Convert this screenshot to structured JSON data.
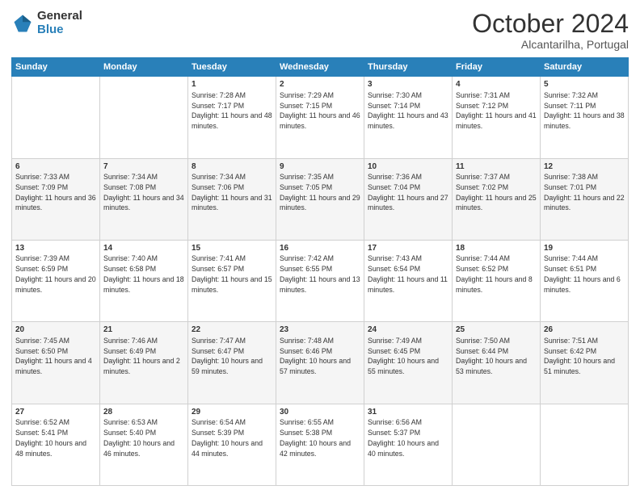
{
  "logo": {
    "general": "General",
    "blue": "Blue"
  },
  "title": "October 2024",
  "subtitle": "Alcantarilha, Portugal",
  "days_header": [
    "Sunday",
    "Monday",
    "Tuesday",
    "Wednesday",
    "Thursday",
    "Friday",
    "Saturday"
  ],
  "weeks": [
    [
      {
        "num": "",
        "sunrise": "",
        "sunset": "",
        "daylight": ""
      },
      {
        "num": "",
        "sunrise": "",
        "sunset": "",
        "daylight": ""
      },
      {
        "num": "1",
        "sunrise": "Sunrise: 7:28 AM",
        "sunset": "Sunset: 7:17 PM",
        "daylight": "Daylight: 11 hours and 48 minutes."
      },
      {
        "num": "2",
        "sunrise": "Sunrise: 7:29 AM",
        "sunset": "Sunset: 7:15 PM",
        "daylight": "Daylight: 11 hours and 46 minutes."
      },
      {
        "num": "3",
        "sunrise": "Sunrise: 7:30 AM",
        "sunset": "Sunset: 7:14 PM",
        "daylight": "Daylight: 11 hours and 43 minutes."
      },
      {
        "num": "4",
        "sunrise": "Sunrise: 7:31 AM",
        "sunset": "Sunset: 7:12 PM",
        "daylight": "Daylight: 11 hours and 41 minutes."
      },
      {
        "num": "5",
        "sunrise": "Sunrise: 7:32 AM",
        "sunset": "Sunset: 7:11 PM",
        "daylight": "Daylight: 11 hours and 38 minutes."
      }
    ],
    [
      {
        "num": "6",
        "sunrise": "Sunrise: 7:33 AM",
        "sunset": "Sunset: 7:09 PM",
        "daylight": "Daylight: 11 hours and 36 minutes."
      },
      {
        "num": "7",
        "sunrise": "Sunrise: 7:34 AM",
        "sunset": "Sunset: 7:08 PM",
        "daylight": "Daylight: 11 hours and 34 minutes."
      },
      {
        "num": "8",
        "sunrise": "Sunrise: 7:34 AM",
        "sunset": "Sunset: 7:06 PM",
        "daylight": "Daylight: 11 hours and 31 minutes."
      },
      {
        "num": "9",
        "sunrise": "Sunrise: 7:35 AM",
        "sunset": "Sunset: 7:05 PM",
        "daylight": "Daylight: 11 hours and 29 minutes."
      },
      {
        "num": "10",
        "sunrise": "Sunrise: 7:36 AM",
        "sunset": "Sunset: 7:04 PM",
        "daylight": "Daylight: 11 hours and 27 minutes."
      },
      {
        "num": "11",
        "sunrise": "Sunrise: 7:37 AM",
        "sunset": "Sunset: 7:02 PM",
        "daylight": "Daylight: 11 hours and 25 minutes."
      },
      {
        "num": "12",
        "sunrise": "Sunrise: 7:38 AM",
        "sunset": "Sunset: 7:01 PM",
        "daylight": "Daylight: 11 hours and 22 minutes."
      }
    ],
    [
      {
        "num": "13",
        "sunrise": "Sunrise: 7:39 AM",
        "sunset": "Sunset: 6:59 PM",
        "daylight": "Daylight: 11 hours and 20 minutes."
      },
      {
        "num": "14",
        "sunrise": "Sunrise: 7:40 AM",
        "sunset": "Sunset: 6:58 PM",
        "daylight": "Daylight: 11 hours and 18 minutes."
      },
      {
        "num": "15",
        "sunrise": "Sunrise: 7:41 AM",
        "sunset": "Sunset: 6:57 PM",
        "daylight": "Daylight: 11 hours and 15 minutes."
      },
      {
        "num": "16",
        "sunrise": "Sunrise: 7:42 AM",
        "sunset": "Sunset: 6:55 PM",
        "daylight": "Daylight: 11 hours and 13 minutes."
      },
      {
        "num": "17",
        "sunrise": "Sunrise: 7:43 AM",
        "sunset": "Sunset: 6:54 PM",
        "daylight": "Daylight: 11 hours and 11 minutes."
      },
      {
        "num": "18",
        "sunrise": "Sunrise: 7:44 AM",
        "sunset": "Sunset: 6:52 PM",
        "daylight": "Daylight: 11 hours and 8 minutes."
      },
      {
        "num": "19",
        "sunrise": "Sunrise: 7:44 AM",
        "sunset": "Sunset: 6:51 PM",
        "daylight": "Daylight: 11 hours and 6 minutes."
      }
    ],
    [
      {
        "num": "20",
        "sunrise": "Sunrise: 7:45 AM",
        "sunset": "Sunset: 6:50 PM",
        "daylight": "Daylight: 11 hours and 4 minutes."
      },
      {
        "num": "21",
        "sunrise": "Sunrise: 7:46 AM",
        "sunset": "Sunset: 6:49 PM",
        "daylight": "Daylight: 11 hours and 2 minutes."
      },
      {
        "num": "22",
        "sunrise": "Sunrise: 7:47 AM",
        "sunset": "Sunset: 6:47 PM",
        "daylight": "Daylight: 10 hours and 59 minutes."
      },
      {
        "num": "23",
        "sunrise": "Sunrise: 7:48 AM",
        "sunset": "Sunset: 6:46 PM",
        "daylight": "Daylight: 10 hours and 57 minutes."
      },
      {
        "num": "24",
        "sunrise": "Sunrise: 7:49 AM",
        "sunset": "Sunset: 6:45 PM",
        "daylight": "Daylight: 10 hours and 55 minutes."
      },
      {
        "num": "25",
        "sunrise": "Sunrise: 7:50 AM",
        "sunset": "Sunset: 6:44 PM",
        "daylight": "Daylight: 10 hours and 53 minutes."
      },
      {
        "num": "26",
        "sunrise": "Sunrise: 7:51 AM",
        "sunset": "Sunset: 6:42 PM",
        "daylight": "Daylight: 10 hours and 51 minutes."
      }
    ],
    [
      {
        "num": "27",
        "sunrise": "Sunrise: 6:52 AM",
        "sunset": "Sunset: 5:41 PM",
        "daylight": "Daylight: 10 hours and 48 minutes."
      },
      {
        "num": "28",
        "sunrise": "Sunrise: 6:53 AM",
        "sunset": "Sunset: 5:40 PM",
        "daylight": "Daylight: 10 hours and 46 minutes."
      },
      {
        "num": "29",
        "sunrise": "Sunrise: 6:54 AM",
        "sunset": "Sunset: 5:39 PM",
        "daylight": "Daylight: 10 hours and 44 minutes."
      },
      {
        "num": "30",
        "sunrise": "Sunrise: 6:55 AM",
        "sunset": "Sunset: 5:38 PM",
        "daylight": "Daylight: 10 hours and 42 minutes."
      },
      {
        "num": "31",
        "sunrise": "Sunrise: 6:56 AM",
        "sunset": "Sunset: 5:37 PM",
        "daylight": "Daylight: 10 hours and 40 minutes."
      },
      {
        "num": "",
        "sunrise": "",
        "sunset": "",
        "daylight": ""
      },
      {
        "num": "",
        "sunrise": "",
        "sunset": "",
        "daylight": ""
      }
    ]
  ]
}
